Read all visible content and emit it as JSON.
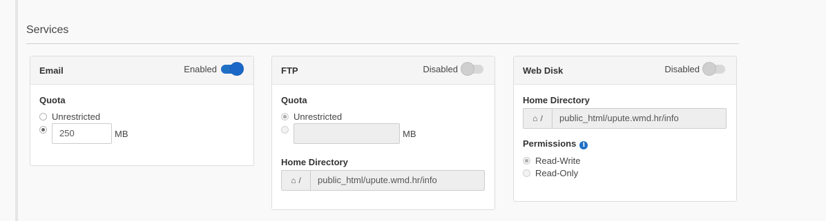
{
  "section": {
    "title": "Services"
  },
  "email": {
    "title": "Email",
    "status": "Enabled",
    "quota_label": "Quota",
    "unrestricted_label": "Unrestricted",
    "quota_value": "250",
    "quota_unit": "MB"
  },
  "ftp": {
    "title": "FTP",
    "status": "Disabled",
    "quota_label": "Quota",
    "unrestricted_label": "Unrestricted",
    "quota_value": "",
    "quota_unit": "MB",
    "home_label": "Home Directory",
    "home_prefix": "/",
    "home_path": "public_html/upute.wmd.hr/info"
  },
  "webdisk": {
    "title": "Web Disk",
    "status": "Disabled",
    "home_label": "Home Directory",
    "home_prefix": "/",
    "home_path": "public_html/upute.wmd.hr/info",
    "permissions_label": "Permissions",
    "rw_label": "Read-Write",
    "ro_label": "Read-Only"
  },
  "colors": {
    "accent": "#1f6fc5",
    "toggle_off": "#d8d8d8"
  },
  "icons": {
    "home": "home-icon",
    "info": "info-icon"
  }
}
